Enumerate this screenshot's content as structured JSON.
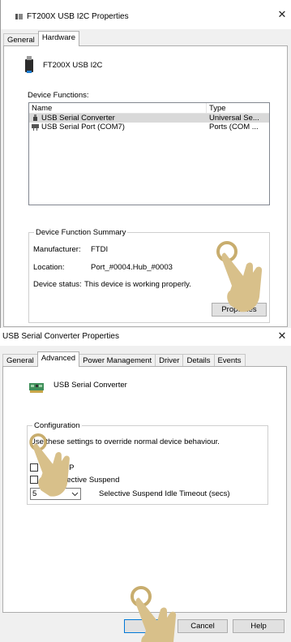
{
  "top_dialog": {
    "title": "FT200X USB I2C Properties",
    "close_symbol": "✕",
    "tabs": [
      {
        "label": "General",
        "active": false
      },
      {
        "label": "Hardware",
        "active": true
      }
    ],
    "device_name": "FT200X USB I2C",
    "device_functions_label": "Device Functions:",
    "columns": {
      "name": "Name",
      "type": "Type"
    },
    "rows": [
      {
        "name": "USB Serial Converter",
        "type": "Universal Se...",
        "selected": true,
        "icon": "usb-plug-icon"
      },
      {
        "name": "USB Serial Port (COM7)",
        "type": "Ports (COM ...",
        "selected": false,
        "icon": "serial-port-icon"
      }
    ],
    "summary": {
      "title": "Device Function Summary",
      "manufacturer_label": "Manufacturer:",
      "manufacturer_value": "FTDI",
      "location_label": "Location:",
      "location_value": "Port_#0004.Hub_#0003",
      "status_label": "Device status:",
      "status_value": "This device is working properly."
    },
    "properties_button": "Properties"
  },
  "bottom_dialog": {
    "title": "USB Serial Converter Properties",
    "close_symbol": "✕",
    "tabs": [
      {
        "label": "General",
        "active": false
      },
      {
        "label": "Advanced",
        "active": true
      },
      {
        "label": "Power Management",
        "active": false
      },
      {
        "label": "Driver",
        "active": false
      },
      {
        "label": "Details",
        "active": false
      },
      {
        "label": "Events",
        "active": false
      }
    ],
    "device_name": "USB Serial Converter",
    "configuration": {
      "title": "Configuration",
      "description": "Use these settings to override normal device behaviour.",
      "checkbox1_label_visible": "d VCP",
      "checkbox2_label_visible": "elective Suspend",
      "timeout_value": "5",
      "timeout_label": "Selective Suspend Idle Timeout (secs)"
    },
    "buttons": {
      "ok": "",
      "cancel": "Cancel",
      "help": "Help"
    }
  },
  "icons": [
    "usb-device-icon",
    "pci-card-icon",
    "hand-pointer-icon"
  ],
  "colors": {
    "accent": "#0078d7",
    "selection": "#d9d9d9",
    "hand": "#d8c08a",
    "hand_ring": "#c8ad6e"
  }
}
